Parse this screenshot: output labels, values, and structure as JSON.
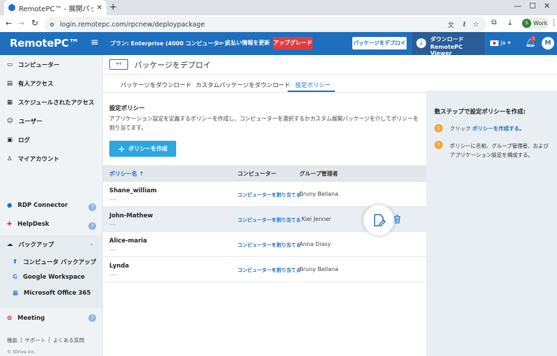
{
  "browser": {
    "tab_title": "RemotePC™ - 展開パッケージ",
    "url": "login.remotepc.com/rpcnew/deploypackage",
    "profile_label": "Work",
    "profile_initial": "S"
  },
  "header": {
    "logo": "RemotePC™",
    "plan": "プラン: Enterprise (4000 コンピューター)",
    "billing": "支払い情報を更新",
    "upgrade": "アップグレード",
    "deploy_button": "パッケージをデプロイ",
    "download_line1": "ダウンロード",
    "download_line2": "RemotePC Viewer",
    "lang": "Ja",
    "notifications": "1",
    "avatar": "M"
  },
  "sidebar": {
    "items": [
      {
        "label": "コンピューター"
      },
      {
        "label": "有人アクセス"
      },
      {
        "label": "スケジュールされたアクセス"
      },
      {
        "label": "ユーザー"
      },
      {
        "label": "ログ"
      },
      {
        "label": "マイアカウント"
      }
    ],
    "rdp": "RDP Connector",
    "helpdesk": "HelpDesk",
    "backup": "バックアップ",
    "backup_items": [
      {
        "label": "コンピュータ バックアップ"
      },
      {
        "label": "Google Workspace"
      },
      {
        "label": "Microsoft Office 365"
      }
    ],
    "meeting": "Meeting",
    "footer_links": [
      "機能",
      "サポート",
      "よくある質問"
    ],
    "copyright": "© IDrive Inc."
  },
  "main": {
    "page_title": "パッケージをデプロイ",
    "tabs": [
      "パッケージをダウンロード",
      "カスタムパッケージをダウンロード",
      "設定ポリシー"
    ],
    "section_title": "設定ポリシー",
    "description": "アプリケーション設定を定義するポリシーを作成し、コンピューターを選択するかカスタム展開パッケージを介してポリシーを割り当てます。",
    "create_button": "ポリシーを作成",
    "table": {
      "columns": [
        "ポリシー名",
        "コンピューター",
        "グループ管理者"
      ],
      "rows": [
        {
          "name": "Shane_william",
          "sub": "----",
          "link": "コンピューターを割り当てる",
          "group": "Bruny Bellana"
        },
        {
          "name": "John-Mathew",
          "sub": "----",
          "link": "コンピューターを割り当てる",
          "group": "Kiel Jenner"
        },
        {
          "name": "Alice-maria",
          "sub": "----",
          "link": "コンピューターを割り当てる",
          "group": "Anna Diasy"
        },
        {
          "name": "Lynda",
          "sub": "----",
          "link": "コンピューターを割り当てる",
          "group": "Bruny Bellana"
        }
      ]
    }
  },
  "help_panel": {
    "title": "数ステップで設定ポリシーを作成:",
    "steps": [
      {
        "num": "1",
        "text": "クリック",
        "link": "ポリシーを作成する。"
      },
      {
        "num": "2",
        "text": "ポリシーに名前、グループ管理者、およびアプリケーション設定を構成する。"
      }
    ]
  }
}
